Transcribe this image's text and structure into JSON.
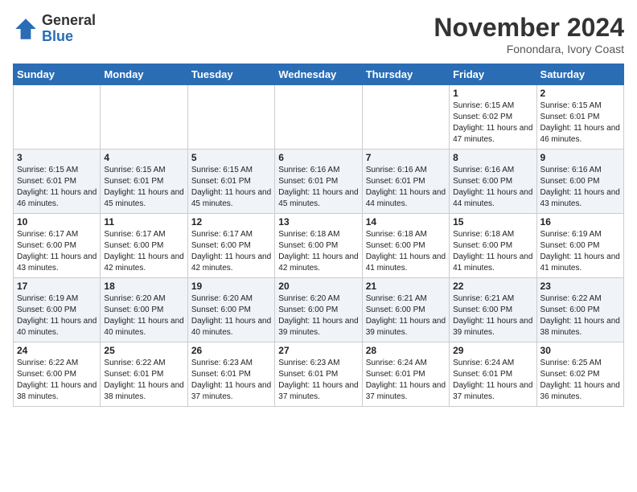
{
  "header": {
    "logo_general": "General",
    "logo_blue": "Blue",
    "month_year": "November 2024",
    "location": "Fonondara, Ivory Coast"
  },
  "days_of_week": [
    "Sunday",
    "Monday",
    "Tuesday",
    "Wednesday",
    "Thursday",
    "Friday",
    "Saturday"
  ],
  "weeks": [
    [
      {
        "day": "",
        "info": ""
      },
      {
        "day": "",
        "info": ""
      },
      {
        "day": "",
        "info": ""
      },
      {
        "day": "",
        "info": ""
      },
      {
        "day": "",
        "info": ""
      },
      {
        "day": "1",
        "info": "Sunrise: 6:15 AM\nSunset: 6:02 PM\nDaylight: 11 hours and 47 minutes."
      },
      {
        "day": "2",
        "info": "Sunrise: 6:15 AM\nSunset: 6:01 PM\nDaylight: 11 hours and 46 minutes."
      }
    ],
    [
      {
        "day": "3",
        "info": "Sunrise: 6:15 AM\nSunset: 6:01 PM\nDaylight: 11 hours and 46 minutes."
      },
      {
        "day": "4",
        "info": "Sunrise: 6:15 AM\nSunset: 6:01 PM\nDaylight: 11 hours and 45 minutes."
      },
      {
        "day": "5",
        "info": "Sunrise: 6:15 AM\nSunset: 6:01 PM\nDaylight: 11 hours and 45 minutes."
      },
      {
        "day": "6",
        "info": "Sunrise: 6:16 AM\nSunset: 6:01 PM\nDaylight: 11 hours and 45 minutes."
      },
      {
        "day": "7",
        "info": "Sunrise: 6:16 AM\nSunset: 6:01 PM\nDaylight: 11 hours and 44 minutes."
      },
      {
        "day": "8",
        "info": "Sunrise: 6:16 AM\nSunset: 6:00 PM\nDaylight: 11 hours and 44 minutes."
      },
      {
        "day": "9",
        "info": "Sunrise: 6:16 AM\nSunset: 6:00 PM\nDaylight: 11 hours and 43 minutes."
      }
    ],
    [
      {
        "day": "10",
        "info": "Sunrise: 6:17 AM\nSunset: 6:00 PM\nDaylight: 11 hours and 43 minutes."
      },
      {
        "day": "11",
        "info": "Sunrise: 6:17 AM\nSunset: 6:00 PM\nDaylight: 11 hours and 42 minutes."
      },
      {
        "day": "12",
        "info": "Sunrise: 6:17 AM\nSunset: 6:00 PM\nDaylight: 11 hours and 42 minutes."
      },
      {
        "day": "13",
        "info": "Sunrise: 6:18 AM\nSunset: 6:00 PM\nDaylight: 11 hours and 42 minutes."
      },
      {
        "day": "14",
        "info": "Sunrise: 6:18 AM\nSunset: 6:00 PM\nDaylight: 11 hours and 41 minutes."
      },
      {
        "day": "15",
        "info": "Sunrise: 6:18 AM\nSunset: 6:00 PM\nDaylight: 11 hours and 41 minutes."
      },
      {
        "day": "16",
        "info": "Sunrise: 6:19 AM\nSunset: 6:00 PM\nDaylight: 11 hours and 41 minutes."
      }
    ],
    [
      {
        "day": "17",
        "info": "Sunrise: 6:19 AM\nSunset: 6:00 PM\nDaylight: 11 hours and 40 minutes."
      },
      {
        "day": "18",
        "info": "Sunrise: 6:20 AM\nSunset: 6:00 PM\nDaylight: 11 hours and 40 minutes."
      },
      {
        "day": "19",
        "info": "Sunrise: 6:20 AM\nSunset: 6:00 PM\nDaylight: 11 hours and 40 minutes."
      },
      {
        "day": "20",
        "info": "Sunrise: 6:20 AM\nSunset: 6:00 PM\nDaylight: 11 hours and 39 minutes."
      },
      {
        "day": "21",
        "info": "Sunrise: 6:21 AM\nSunset: 6:00 PM\nDaylight: 11 hours and 39 minutes."
      },
      {
        "day": "22",
        "info": "Sunrise: 6:21 AM\nSunset: 6:00 PM\nDaylight: 11 hours and 39 minutes."
      },
      {
        "day": "23",
        "info": "Sunrise: 6:22 AM\nSunset: 6:00 PM\nDaylight: 11 hours and 38 minutes."
      }
    ],
    [
      {
        "day": "24",
        "info": "Sunrise: 6:22 AM\nSunset: 6:00 PM\nDaylight: 11 hours and 38 minutes."
      },
      {
        "day": "25",
        "info": "Sunrise: 6:22 AM\nSunset: 6:01 PM\nDaylight: 11 hours and 38 minutes."
      },
      {
        "day": "26",
        "info": "Sunrise: 6:23 AM\nSunset: 6:01 PM\nDaylight: 11 hours and 37 minutes."
      },
      {
        "day": "27",
        "info": "Sunrise: 6:23 AM\nSunset: 6:01 PM\nDaylight: 11 hours and 37 minutes."
      },
      {
        "day": "28",
        "info": "Sunrise: 6:24 AM\nSunset: 6:01 PM\nDaylight: 11 hours and 37 minutes."
      },
      {
        "day": "29",
        "info": "Sunrise: 6:24 AM\nSunset: 6:01 PM\nDaylight: 11 hours and 37 minutes."
      },
      {
        "day": "30",
        "info": "Sunrise: 6:25 AM\nSunset: 6:02 PM\nDaylight: 11 hours and 36 minutes."
      }
    ]
  ]
}
